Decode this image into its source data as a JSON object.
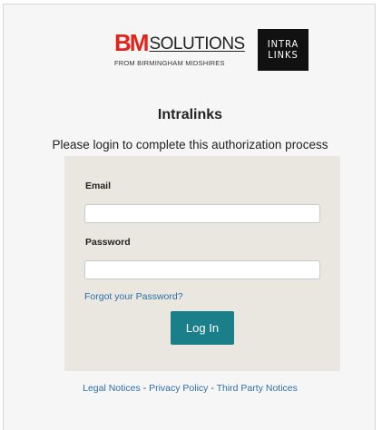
{
  "logos": {
    "bm_mark": "BM",
    "bm_word": "SOLUTIONS",
    "bm_tagline": "FROM BIRMINGHAM MIDSHIRES",
    "intralinks_line1": "INTRA",
    "intralinks_line2": "LINKS"
  },
  "title": "Intralinks",
  "subtitle": "Please login to complete this authorization process",
  "form": {
    "email_label": "Email",
    "email_value": "",
    "password_label": "Password",
    "password_value": "",
    "forgot_link": "Forgot your Password?",
    "login_button": "Log In"
  },
  "footer": {
    "legal": "Legal Notices",
    "sep1": " - ",
    "privacy": "Privacy Policy",
    "sep2": " - ",
    "third_party": "Third Party Notices"
  },
  "colors": {
    "brand_red": "#e2231a",
    "button_teal": "#1b7f8a",
    "link_blue": "#2e6fa7",
    "panel_bg": "#e9e7df"
  }
}
